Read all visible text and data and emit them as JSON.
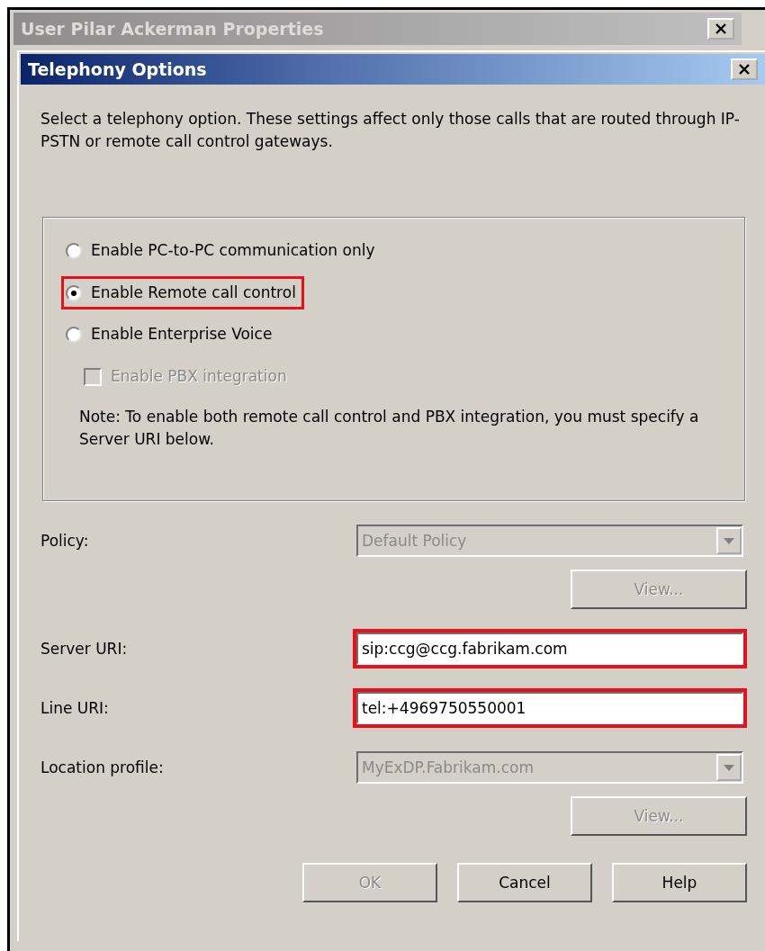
{
  "outer_window": {
    "title": "User Pilar Ackerman Properties"
  },
  "dialog": {
    "title": "Telephony Options",
    "intro": "Select a telephony option. These settings affect only those calls that are routed through IP-PSTN or remote call control gateways.",
    "options": [
      {
        "label": "Enable PC-to-PC communication only",
        "selected": false,
        "highlighted": false
      },
      {
        "label": "Enable Remote call control",
        "selected": true,
        "highlighted": true
      },
      {
        "label": "Enable Enterprise Voice",
        "selected": false,
        "highlighted": false
      }
    ],
    "pbx": {
      "label": "Enable PBX integration",
      "checked": false,
      "disabled": true
    },
    "note": "Note: To enable both remote call control and PBX integration, you must specify a Server URI below.",
    "fields": [
      {
        "label": "Policy:",
        "kind": "select",
        "value": "Default Policy",
        "disabled": true,
        "highlighted": false,
        "view_button": {
          "label": "View...",
          "disabled": true
        }
      },
      {
        "label": "Server URI:",
        "kind": "text",
        "value": "sip:ccg@ccg.fabrikam.com",
        "disabled": false,
        "highlighted": true
      },
      {
        "label": "Line URI:",
        "kind": "text",
        "value": "tel:+4969750550001",
        "disabled": false,
        "highlighted": true
      },
      {
        "label": "Location profile:",
        "kind": "select",
        "value": "MyExDP.Fabrikam.com",
        "disabled": true,
        "highlighted": false,
        "view_button": {
          "label": "View...",
          "disabled": true
        }
      }
    ],
    "buttons": [
      {
        "label": "OK",
        "disabled": true
      },
      {
        "label": "Cancel",
        "disabled": false
      },
      {
        "label": "Help",
        "disabled": false
      }
    ]
  }
}
